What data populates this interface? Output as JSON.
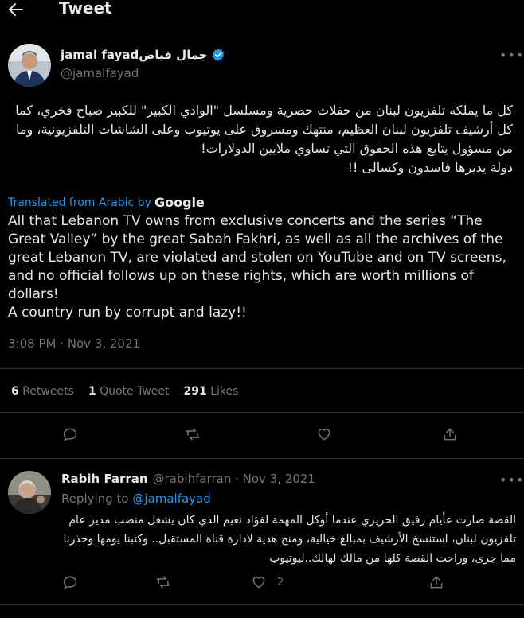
{
  "header": {
    "title": "Tweet",
    "back_icon": "arrow-left-icon"
  },
  "tweet": {
    "display_name": "jamal fayadجمال فياض",
    "handle": "@jamalfayad",
    "verified": true,
    "arabic_text": "كل ما يملكه تلفزيون لبنان من حفلات حصرية ومسلسل \"الوادي الكبير\" للكبير صباح فخري، كما كل أرشيف تلفزيون لبنان العظيم، منتهك ومسروق على يوتيوب وعلى الشاشات التلفزيونية، وما من مسؤول يتابع هذه الحقوق التي تساوي ملايين الدولارات!\nدولة يديرها فاسدون وكسالى !!",
    "translated_label": "Translated from Arabic by",
    "translated_provider": "Google",
    "english_text": "All that Lebanon TV owns from exclusive concerts and the series “The Great Valley” by the great Sabah Fakhri, as well as all the archives of the great Lebanon TV, are violated and stolen on YouTube and on TV screens, and no official follows up on these rights, which are worth millions of dollars!\nA country run by corrupt and lazy!!",
    "timestamp": "3:08 PM · Nov 3, 2021",
    "stats": {
      "retweets_count": "6",
      "retweets_label": "Retweets",
      "quotes_count": "1",
      "quotes_label": "Quote Tweet",
      "likes_count": "291",
      "likes_label": "Likes"
    },
    "action_icons": [
      "reply-icon",
      "retweet-icon",
      "like-icon",
      "share-icon"
    ]
  },
  "reply": {
    "display_name": "Rabih Farran",
    "handle_date": "@rabihfarran · Nov 3, 2021",
    "replying_label": "Replying to",
    "replying_handle": "@jamalfayad",
    "text": "القصة صارت عأيام رفيق الحريري عندما أوكل المهمة لفؤاد نعيم الذي كان يشغل منصب مدير عام تلفزيون لبنان، استنسخ الأرشيف بمبالغ خيالية، ومنح هدية لادارة قناة المستقبل.. وكتبنا يومها وحذرنا مما جرى، وراحت القصة كلها من مالك لهالك..ليوتيوب",
    "like_count": "2"
  },
  "colors": {
    "accent": "#1d9bf0",
    "muted": "#71767b",
    "border": "#2f3336",
    "background": "#000000"
  }
}
